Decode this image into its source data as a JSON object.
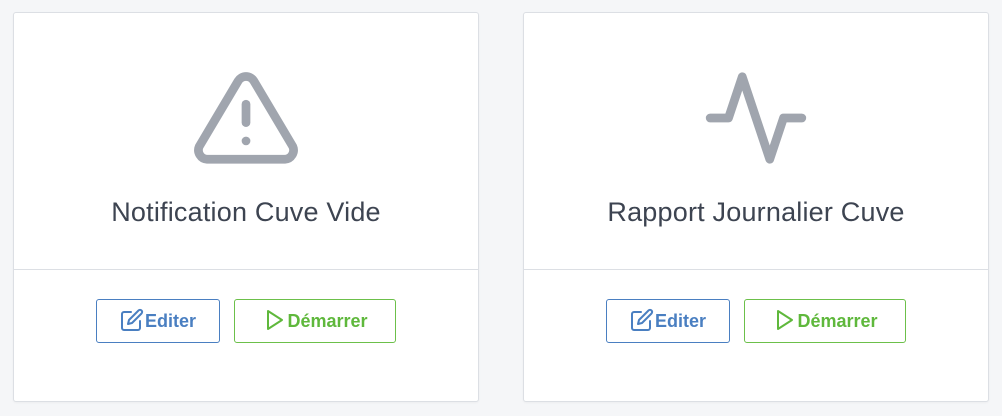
{
  "colors": {
    "edit": "#4a7fc1",
    "start": "#5fb83c",
    "icon": "#a0a5ae",
    "title": "#3d4451"
  },
  "cards": [
    {
      "icon": "warning-triangle-icon",
      "title": "Notification Cuve Vide",
      "edit_label": "Editer",
      "start_label": "Démarrer"
    },
    {
      "icon": "activity-pulse-icon",
      "title": "Rapport Journalier Cuve",
      "edit_label": "Editer",
      "start_label": "Démarrer"
    }
  ]
}
